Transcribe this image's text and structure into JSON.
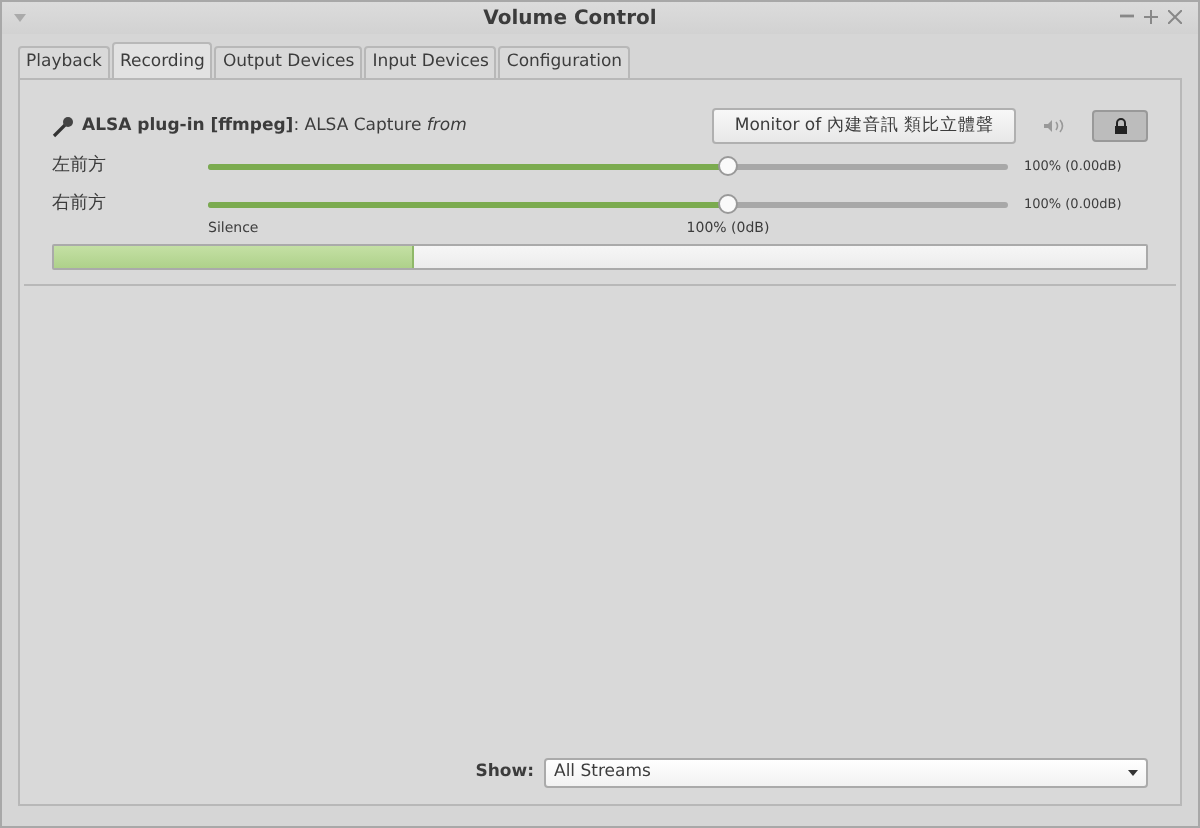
{
  "window": {
    "title": "Volume Control"
  },
  "tabs": [
    {
      "label": "Playback",
      "selected": false
    },
    {
      "label": "Recording",
      "selected": true
    },
    {
      "label": "Output Devices",
      "selected": false
    },
    {
      "label": "Input Devices",
      "selected": false
    },
    {
      "label": "Configuration",
      "selected": false
    }
  ],
  "stream": {
    "name": "ALSA plug-in [ffmpeg]",
    "separator": ": ",
    "description": "ALSA Capture",
    "from": "from",
    "device_button": "Monitor of 內建音訊 類比立體聲",
    "locked": true,
    "channels": [
      {
        "label": "左前方",
        "level": 0.65,
        "reading": "100% (0.00dB)"
      },
      {
        "label": "右前方",
        "level": 0.65,
        "reading": "100% (0.00dB)"
      }
    ],
    "scale": {
      "silence": "Silence",
      "unity": "100% (0dB)"
    },
    "peak": {
      "level": 0.33
    }
  },
  "show": {
    "label": "Show:",
    "value": "All Streams"
  }
}
